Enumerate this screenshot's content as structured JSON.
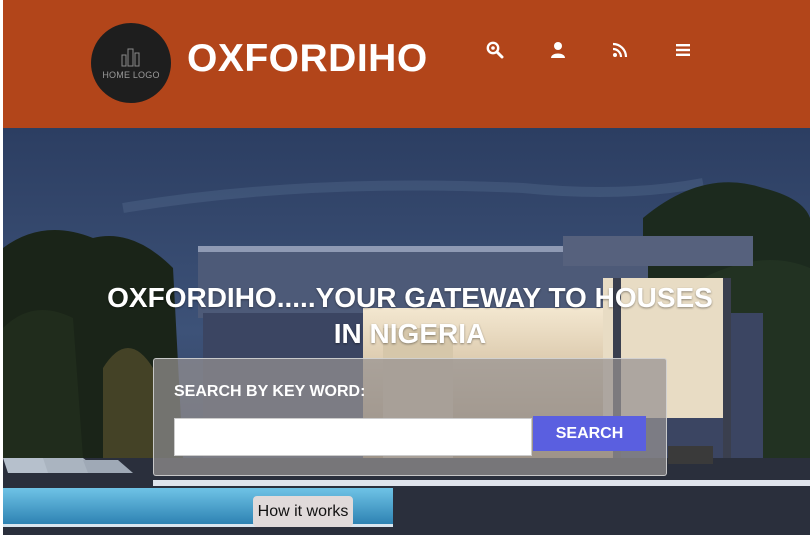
{
  "header": {
    "logo_text": "HOME LOGO",
    "brand": "OXFORDIHO",
    "nav_icons": [
      "search-icon",
      "user-icon",
      "rss-icon",
      "menu-icon"
    ],
    "background_color": "#b2451a"
  },
  "hero": {
    "title": "OXFORDIHO.....YOUR GATEWAY TO HOUSES IN NIGERIA",
    "search": {
      "label": "SEARCH BY KEY WORD:",
      "input_value": "",
      "button_label": "SEARCH"
    },
    "how_it_works_label": "How it works"
  },
  "colors": {
    "accent_button": "#5a5fe0",
    "header": "#b2451a"
  }
}
